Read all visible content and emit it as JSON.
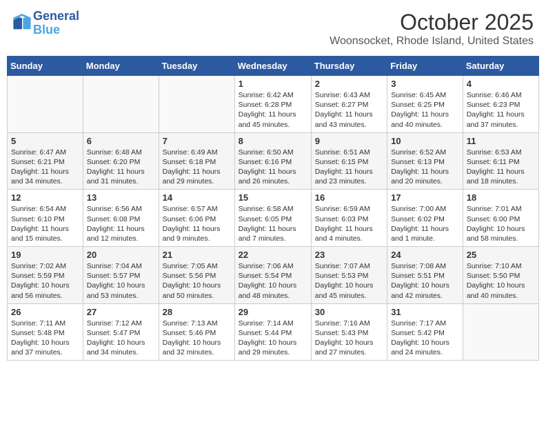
{
  "header": {
    "logo_line1": "General",
    "logo_line2": "Blue",
    "month": "October 2025",
    "location": "Woonsocket, Rhode Island, United States"
  },
  "days_of_week": [
    "Sunday",
    "Monday",
    "Tuesday",
    "Wednesday",
    "Thursday",
    "Friday",
    "Saturday"
  ],
  "weeks": [
    [
      {
        "day": "",
        "sunrise": "",
        "sunset": "",
        "daylight": ""
      },
      {
        "day": "",
        "sunrise": "",
        "sunset": "",
        "daylight": ""
      },
      {
        "day": "",
        "sunrise": "",
        "sunset": "",
        "daylight": ""
      },
      {
        "day": "1",
        "sunrise": "Sunrise: 6:42 AM",
        "sunset": "Sunset: 6:28 PM",
        "daylight": "Daylight: 11 hours and 45 minutes."
      },
      {
        "day": "2",
        "sunrise": "Sunrise: 6:43 AM",
        "sunset": "Sunset: 6:27 PM",
        "daylight": "Daylight: 11 hours and 43 minutes."
      },
      {
        "day": "3",
        "sunrise": "Sunrise: 6:45 AM",
        "sunset": "Sunset: 6:25 PM",
        "daylight": "Daylight: 11 hours and 40 minutes."
      },
      {
        "day": "4",
        "sunrise": "Sunrise: 6:46 AM",
        "sunset": "Sunset: 6:23 PM",
        "daylight": "Daylight: 11 hours and 37 minutes."
      }
    ],
    [
      {
        "day": "5",
        "sunrise": "Sunrise: 6:47 AM",
        "sunset": "Sunset: 6:21 PM",
        "daylight": "Daylight: 11 hours and 34 minutes."
      },
      {
        "day": "6",
        "sunrise": "Sunrise: 6:48 AM",
        "sunset": "Sunset: 6:20 PM",
        "daylight": "Daylight: 11 hours and 31 minutes."
      },
      {
        "day": "7",
        "sunrise": "Sunrise: 6:49 AM",
        "sunset": "Sunset: 6:18 PM",
        "daylight": "Daylight: 11 hours and 29 minutes."
      },
      {
        "day": "8",
        "sunrise": "Sunrise: 6:50 AM",
        "sunset": "Sunset: 6:16 PM",
        "daylight": "Daylight: 11 hours and 26 minutes."
      },
      {
        "day": "9",
        "sunrise": "Sunrise: 6:51 AM",
        "sunset": "Sunset: 6:15 PM",
        "daylight": "Daylight: 11 hours and 23 minutes."
      },
      {
        "day": "10",
        "sunrise": "Sunrise: 6:52 AM",
        "sunset": "Sunset: 6:13 PM",
        "daylight": "Daylight: 11 hours and 20 minutes."
      },
      {
        "day": "11",
        "sunrise": "Sunrise: 6:53 AM",
        "sunset": "Sunset: 6:11 PM",
        "daylight": "Daylight: 11 hours and 18 minutes."
      }
    ],
    [
      {
        "day": "12",
        "sunrise": "Sunrise: 6:54 AM",
        "sunset": "Sunset: 6:10 PM",
        "daylight": "Daylight: 11 hours and 15 minutes."
      },
      {
        "day": "13",
        "sunrise": "Sunrise: 6:56 AM",
        "sunset": "Sunset: 6:08 PM",
        "daylight": "Daylight: 11 hours and 12 minutes."
      },
      {
        "day": "14",
        "sunrise": "Sunrise: 6:57 AM",
        "sunset": "Sunset: 6:06 PM",
        "daylight": "Daylight: 11 hours and 9 minutes."
      },
      {
        "day": "15",
        "sunrise": "Sunrise: 6:58 AM",
        "sunset": "Sunset: 6:05 PM",
        "daylight": "Daylight: 11 hours and 7 minutes."
      },
      {
        "day": "16",
        "sunrise": "Sunrise: 6:59 AM",
        "sunset": "Sunset: 6:03 PM",
        "daylight": "Daylight: 11 hours and 4 minutes."
      },
      {
        "day": "17",
        "sunrise": "Sunrise: 7:00 AM",
        "sunset": "Sunset: 6:02 PM",
        "daylight": "Daylight: 11 hours and 1 minute."
      },
      {
        "day": "18",
        "sunrise": "Sunrise: 7:01 AM",
        "sunset": "Sunset: 6:00 PM",
        "daylight": "Daylight: 10 hours and 58 minutes."
      }
    ],
    [
      {
        "day": "19",
        "sunrise": "Sunrise: 7:02 AM",
        "sunset": "Sunset: 5:59 PM",
        "daylight": "Daylight: 10 hours and 56 minutes."
      },
      {
        "day": "20",
        "sunrise": "Sunrise: 7:04 AM",
        "sunset": "Sunset: 5:57 PM",
        "daylight": "Daylight: 10 hours and 53 minutes."
      },
      {
        "day": "21",
        "sunrise": "Sunrise: 7:05 AM",
        "sunset": "Sunset: 5:56 PM",
        "daylight": "Daylight: 10 hours and 50 minutes."
      },
      {
        "day": "22",
        "sunrise": "Sunrise: 7:06 AM",
        "sunset": "Sunset: 5:54 PM",
        "daylight": "Daylight: 10 hours and 48 minutes."
      },
      {
        "day": "23",
        "sunrise": "Sunrise: 7:07 AM",
        "sunset": "Sunset: 5:53 PM",
        "daylight": "Daylight: 10 hours and 45 minutes."
      },
      {
        "day": "24",
        "sunrise": "Sunrise: 7:08 AM",
        "sunset": "Sunset: 5:51 PM",
        "daylight": "Daylight: 10 hours and 42 minutes."
      },
      {
        "day": "25",
        "sunrise": "Sunrise: 7:10 AM",
        "sunset": "Sunset: 5:50 PM",
        "daylight": "Daylight: 10 hours and 40 minutes."
      }
    ],
    [
      {
        "day": "26",
        "sunrise": "Sunrise: 7:11 AM",
        "sunset": "Sunset: 5:48 PM",
        "daylight": "Daylight: 10 hours and 37 minutes."
      },
      {
        "day": "27",
        "sunrise": "Sunrise: 7:12 AM",
        "sunset": "Sunset: 5:47 PM",
        "daylight": "Daylight: 10 hours and 34 minutes."
      },
      {
        "day": "28",
        "sunrise": "Sunrise: 7:13 AM",
        "sunset": "Sunset: 5:46 PM",
        "daylight": "Daylight: 10 hours and 32 minutes."
      },
      {
        "day": "29",
        "sunrise": "Sunrise: 7:14 AM",
        "sunset": "Sunset: 5:44 PM",
        "daylight": "Daylight: 10 hours and 29 minutes."
      },
      {
        "day": "30",
        "sunrise": "Sunrise: 7:16 AM",
        "sunset": "Sunset: 5:43 PM",
        "daylight": "Daylight: 10 hours and 27 minutes."
      },
      {
        "day": "31",
        "sunrise": "Sunrise: 7:17 AM",
        "sunset": "Sunset: 5:42 PM",
        "daylight": "Daylight: 10 hours and 24 minutes."
      },
      {
        "day": "",
        "sunrise": "",
        "sunset": "",
        "daylight": ""
      }
    ]
  ]
}
